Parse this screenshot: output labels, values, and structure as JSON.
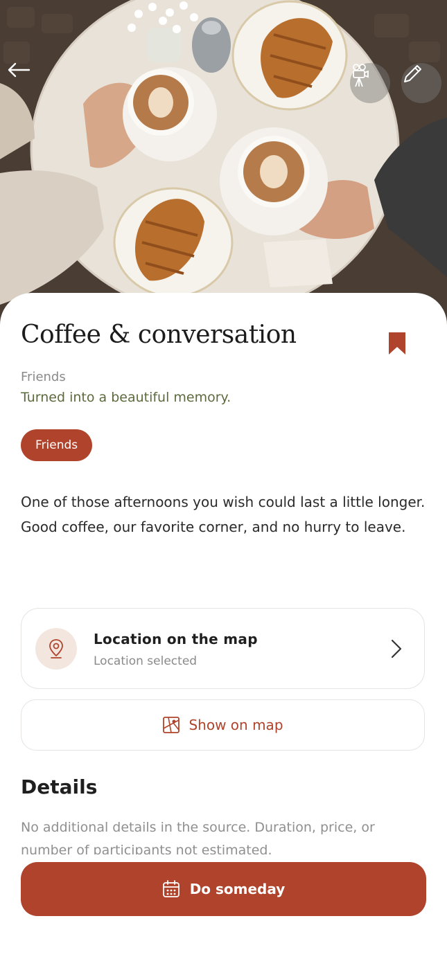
{
  "header": {
    "back_icon": "arrow-left-icon",
    "camera_icon": "movie-camera-icon",
    "edit_icon": "pencil-icon"
  },
  "memory": {
    "title": "Coffee & conversation",
    "category": "Friends",
    "subtitle": "Turned into a beautiful memory.",
    "tag": "Friends",
    "description": "One of those afternoons you wish could last a little longer. Good coffee, our favorite corner, and no hurry to leave.",
    "bookmarked": true
  },
  "location": {
    "title": "Location on the map",
    "status": "Location selected",
    "icon": "map-pin-icon"
  },
  "map_button": {
    "label": "Show on map",
    "icon": "map-icon"
  },
  "details": {
    "heading": "Details",
    "body": "No additional details in the source. Duration, price, or number of participants not estimated."
  },
  "cta": {
    "label": "Do someday",
    "icon": "calendar-icon"
  },
  "colors": {
    "accent": "#b0432b",
    "subtitle_green": "#5b6a3c",
    "muted": "#8a8a8a"
  }
}
